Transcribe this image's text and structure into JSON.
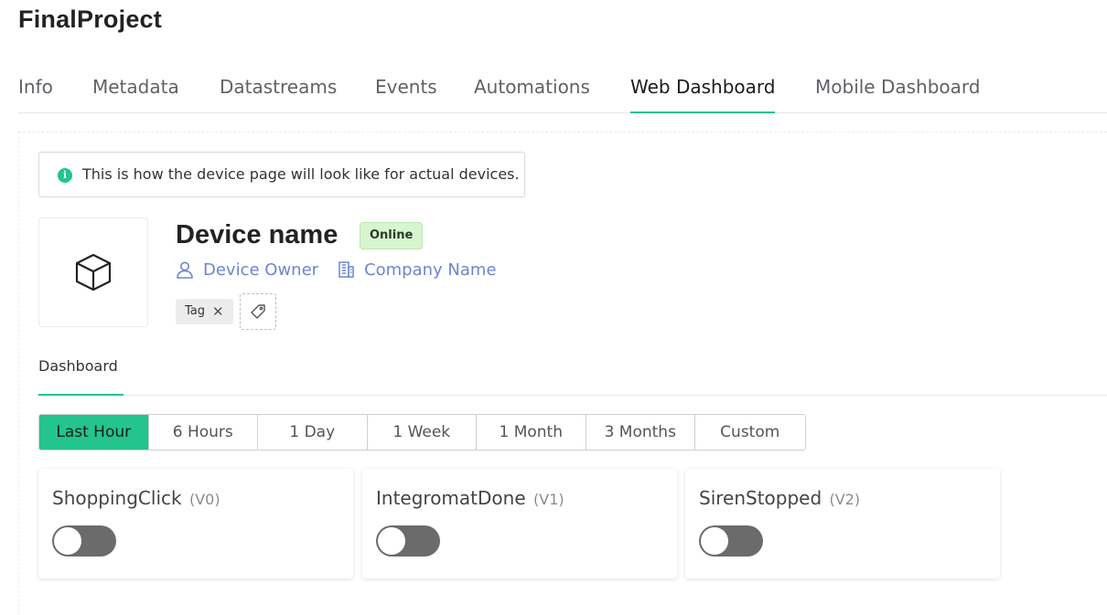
{
  "project": {
    "title": "FinalProject"
  },
  "tabs": [
    {
      "label": "Info"
    },
    {
      "label": "Metadata"
    },
    {
      "label": "Datastreams"
    },
    {
      "label": "Events"
    },
    {
      "label": "Automations"
    },
    {
      "label": "Web Dashboard",
      "active": true
    },
    {
      "label": "Mobile Dashboard"
    }
  ],
  "notice": {
    "icon": "info-icon",
    "text": "This is how the device page will look like for actual devices."
  },
  "device": {
    "image_icon": "cube-icon",
    "name": "Device name",
    "status": "Online",
    "owner": "Device Owner",
    "company": "Company Name",
    "tags": [
      "Tag"
    ]
  },
  "subtabs": [
    {
      "label": "Dashboard",
      "active": true
    }
  ],
  "time_ranges": [
    "Last Hour",
    "6 Hours",
    "1 Day",
    "1 Week",
    "1 Month",
    "3 Months",
    "Custom"
  ],
  "selected_range": "Last Hour",
  "widgets": [
    {
      "name": "ShoppingClick",
      "pin": "(V0)",
      "state": "off"
    },
    {
      "name": "IntegromatDone",
      "pin": "(V1)",
      "state": "off"
    },
    {
      "name": "SirenStopped",
      "pin": "(V2)",
      "state": "off"
    }
  ],
  "colors": {
    "accent": "#23c48e",
    "link": "#6f84d1",
    "online_badge": "#d7f5cf",
    "toggle_off": "#6b6b6b"
  }
}
